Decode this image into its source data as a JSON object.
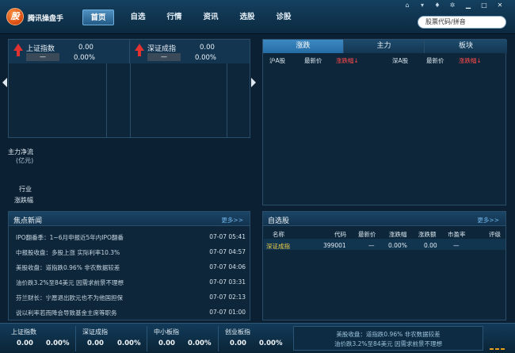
{
  "app": {
    "logo_char": "股",
    "title": "腾讯操盘手"
  },
  "nav": [
    "首页",
    "自选",
    "行情",
    "资讯",
    "选股",
    "诊股"
  ],
  "nav_active": "首页",
  "window_icons": [
    "home-icon",
    "menu-icon",
    "skin-icon",
    "settings-icon",
    "minimize-icon",
    "maximize-icon",
    "close-icon"
  ],
  "search": {
    "placeholder": "股票代码/拼音"
  },
  "indices": [
    {
      "name": "上证指数",
      "change": "—",
      "value": "0.00",
      "pct": "0.00%"
    },
    {
      "name": "深证成指",
      "change": "—",
      "value": "0.00",
      "pct": "0.00%"
    }
  ],
  "left_labels": {
    "fund_flow": "主力净流",
    "fund_unit": "(亿元)",
    "industry": "行业",
    "change_pct": "涨跌幅"
  },
  "rank": {
    "tabs": [
      "涨跌",
      "主力",
      "板块"
    ],
    "active": "涨跌",
    "headers_left": [
      "沪A股",
      "最新价",
      "涨跌幅↓"
    ],
    "headers_right": [
      "深A股",
      "最新价",
      "涨跌幅↓"
    ]
  },
  "news": {
    "title": "焦点新闻",
    "more": "更多>>",
    "items": [
      {
        "title": "IPO翻番季：1~6月申报近5年内IPO翻番",
        "time": "07-07 05:41"
      },
      {
        "title": "中报股收盘：多股上涨 实际利率10.3%",
        "time": "07-07 04:57"
      },
      {
        "title": "美股收盘：道指跌0.96% 非农数据较差",
        "time": "07-07 04:06"
      },
      {
        "title": "油价跌3.2%至84美元 因需求前景不理想",
        "time": "07-07 03:31"
      },
      {
        "title": "芬兰财长：宁愿退出欧元也不为他国担保",
        "time": "07-07 02:13"
      },
      {
        "title": "说以利率若而降会导致基金主席等职务",
        "time": "07-07 01:00"
      }
    ]
  },
  "watchlist": {
    "title": "自选股",
    "more": "更多>>",
    "headers": [
      "名称",
      "代码",
      "最新价",
      "涨跌幅",
      "涨跌额",
      "市盈率",
      "评级"
    ],
    "rows": [
      {
        "name": "深证成指",
        "code": "399001",
        "price": "—",
        "pct": "0.00%",
        "chg": "0.00",
        "pe": "—",
        "rating": ""
      }
    ]
  },
  "ticker": {
    "items": [
      {
        "name": "上证指数",
        "value": "0.00",
        "pct": "0.00%"
      },
      {
        "name": "深证成指",
        "value": "0.00",
        "pct": "0.00%"
      },
      {
        "name": "中小板指",
        "value": "0.00",
        "pct": "0.00%"
      },
      {
        "name": "创业板指",
        "value": "0.00",
        "pct": "0.00%"
      }
    ],
    "news": [
      "美股收盘：道指跌0.96% 非农数据较差",
      "油价跌3.2%至84美元 因需求前景不理想"
    ]
  },
  "colors": {
    "accent": "#3d89c2",
    "up": "#e23131",
    "link": "#6fb3e8",
    "background": "#0b2133"
  }
}
